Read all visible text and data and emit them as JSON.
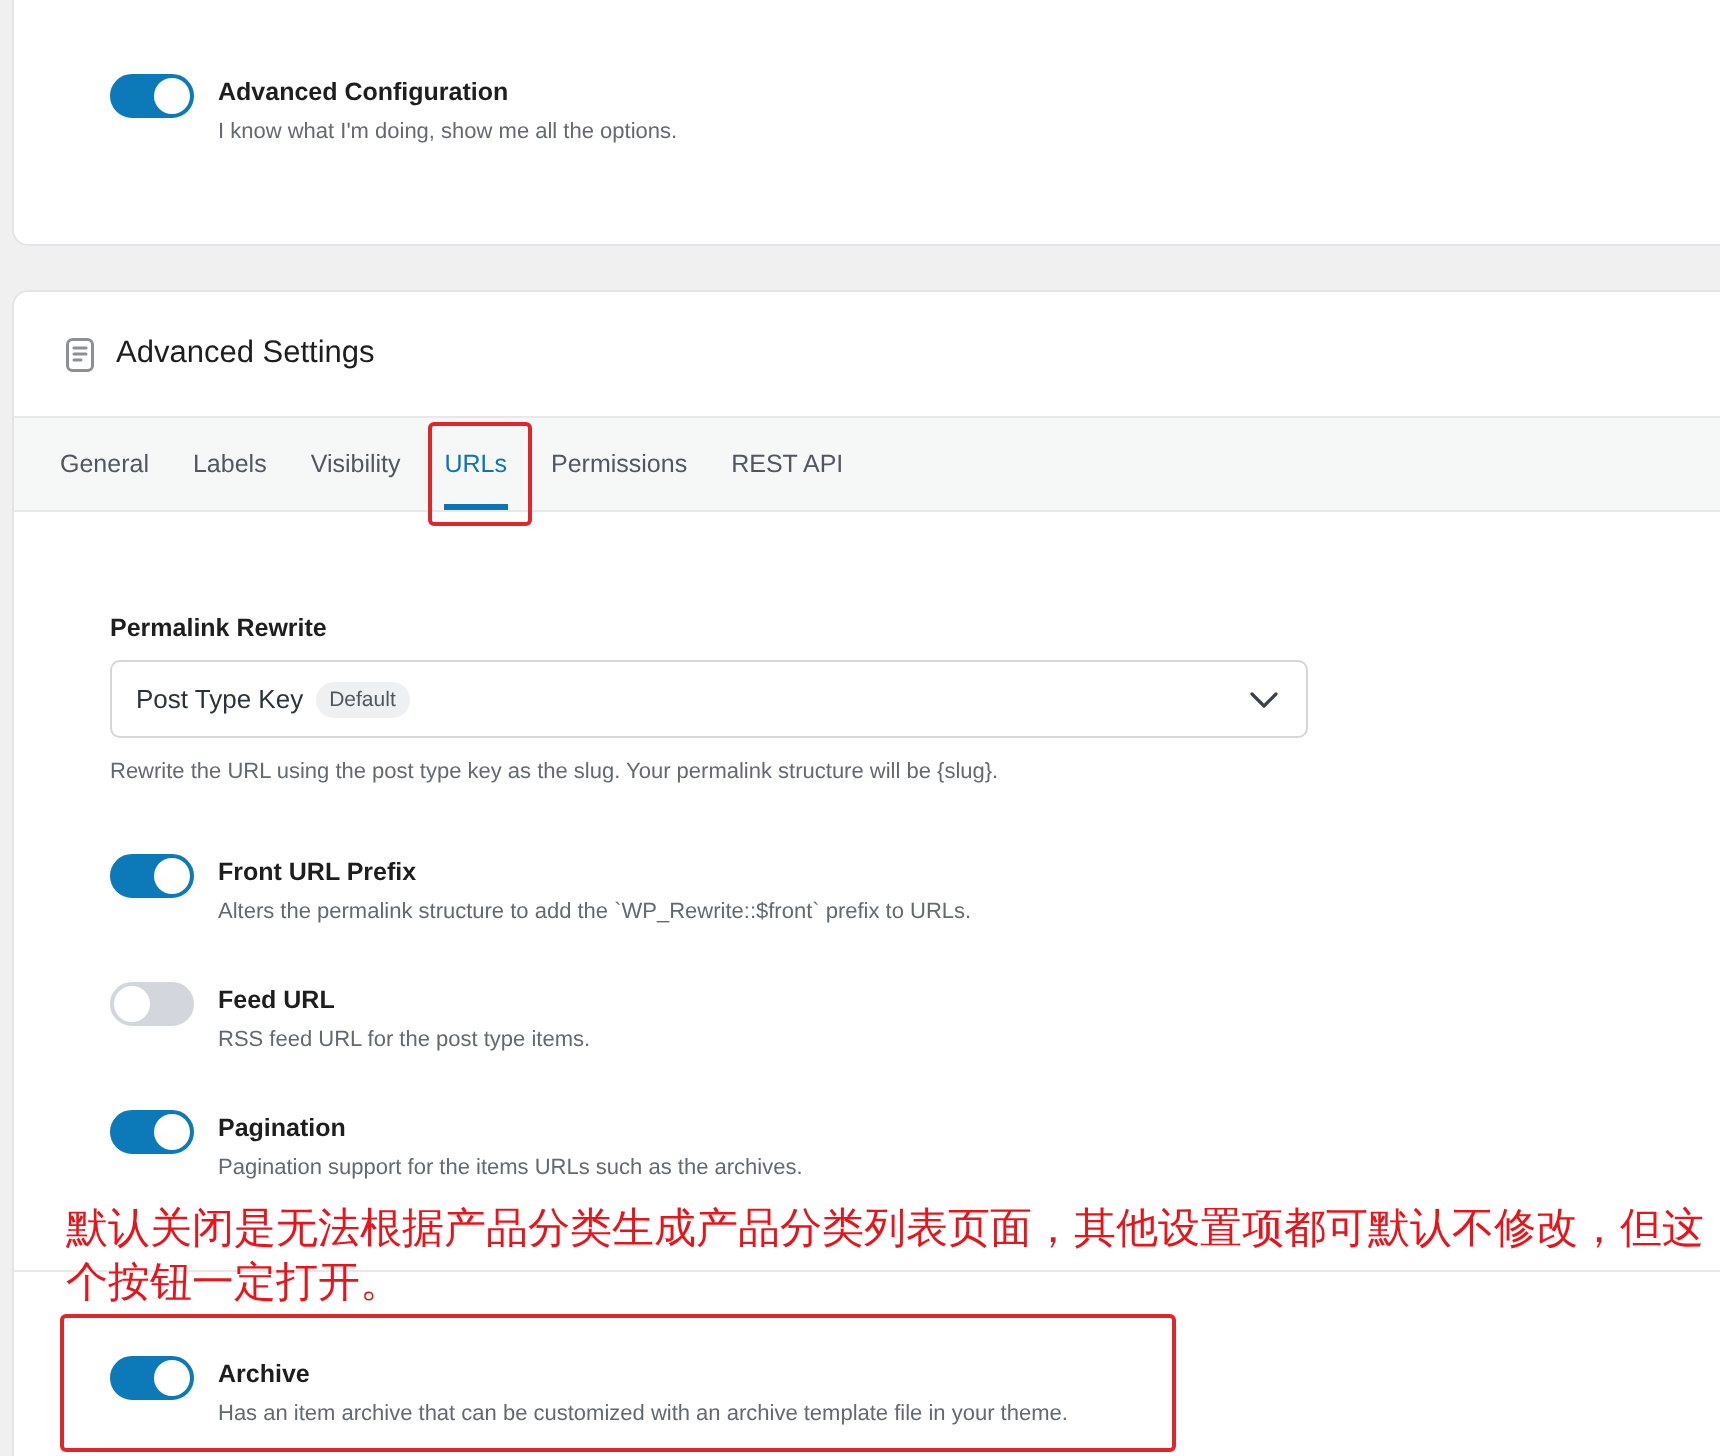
{
  "general": {
    "toggle": {
      "label": "Advanced Configuration",
      "description": "I know what I'm doing, show me all the options.",
      "on": true
    }
  },
  "panel": {
    "title": "Advanced Settings",
    "tabs": [
      {
        "label": "General",
        "selected": false
      },
      {
        "label": "Labels",
        "selected": false
      },
      {
        "label": "Visibility",
        "selected": false
      },
      {
        "label": "URLs",
        "selected": true
      },
      {
        "label": "Permissions",
        "selected": false
      },
      {
        "label": "REST API",
        "selected": false
      }
    ],
    "permalink": {
      "label": "Permalink Rewrite",
      "value": "Post Type Key",
      "badge": "Default",
      "hint": "Rewrite the URL using the post type key as the slug. Your permalink structure will be {slug}."
    },
    "sections": [
      {
        "toggles": [
          {
            "label": "Front URL Prefix",
            "description": "Alters the permalink structure to add the `WP_Rewrite::$front` prefix to URLs.",
            "on": true
          },
          {
            "label": "Feed URL",
            "description": "RSS feed URL for the post type items.",
            "on": false
          },
          {
            "label": "Pagination",
            "description": "Pagination support for the items URLs such as the archives.",
            "on": true
          }
        ]
      },
      {
        "toggles": [
          {
            "label": "Archive",
            "description": "Has an item archive that can be customized with an archive template file in your theme.",
            "on": true
          }
        ]
      }
    ]
  },
  "annotation": {
    "note": "默认关闭是无法根据产品分类生成产品分类列表页面，其他设置项都可默认不修改，但这个按钮一定打开。"
  }
}
